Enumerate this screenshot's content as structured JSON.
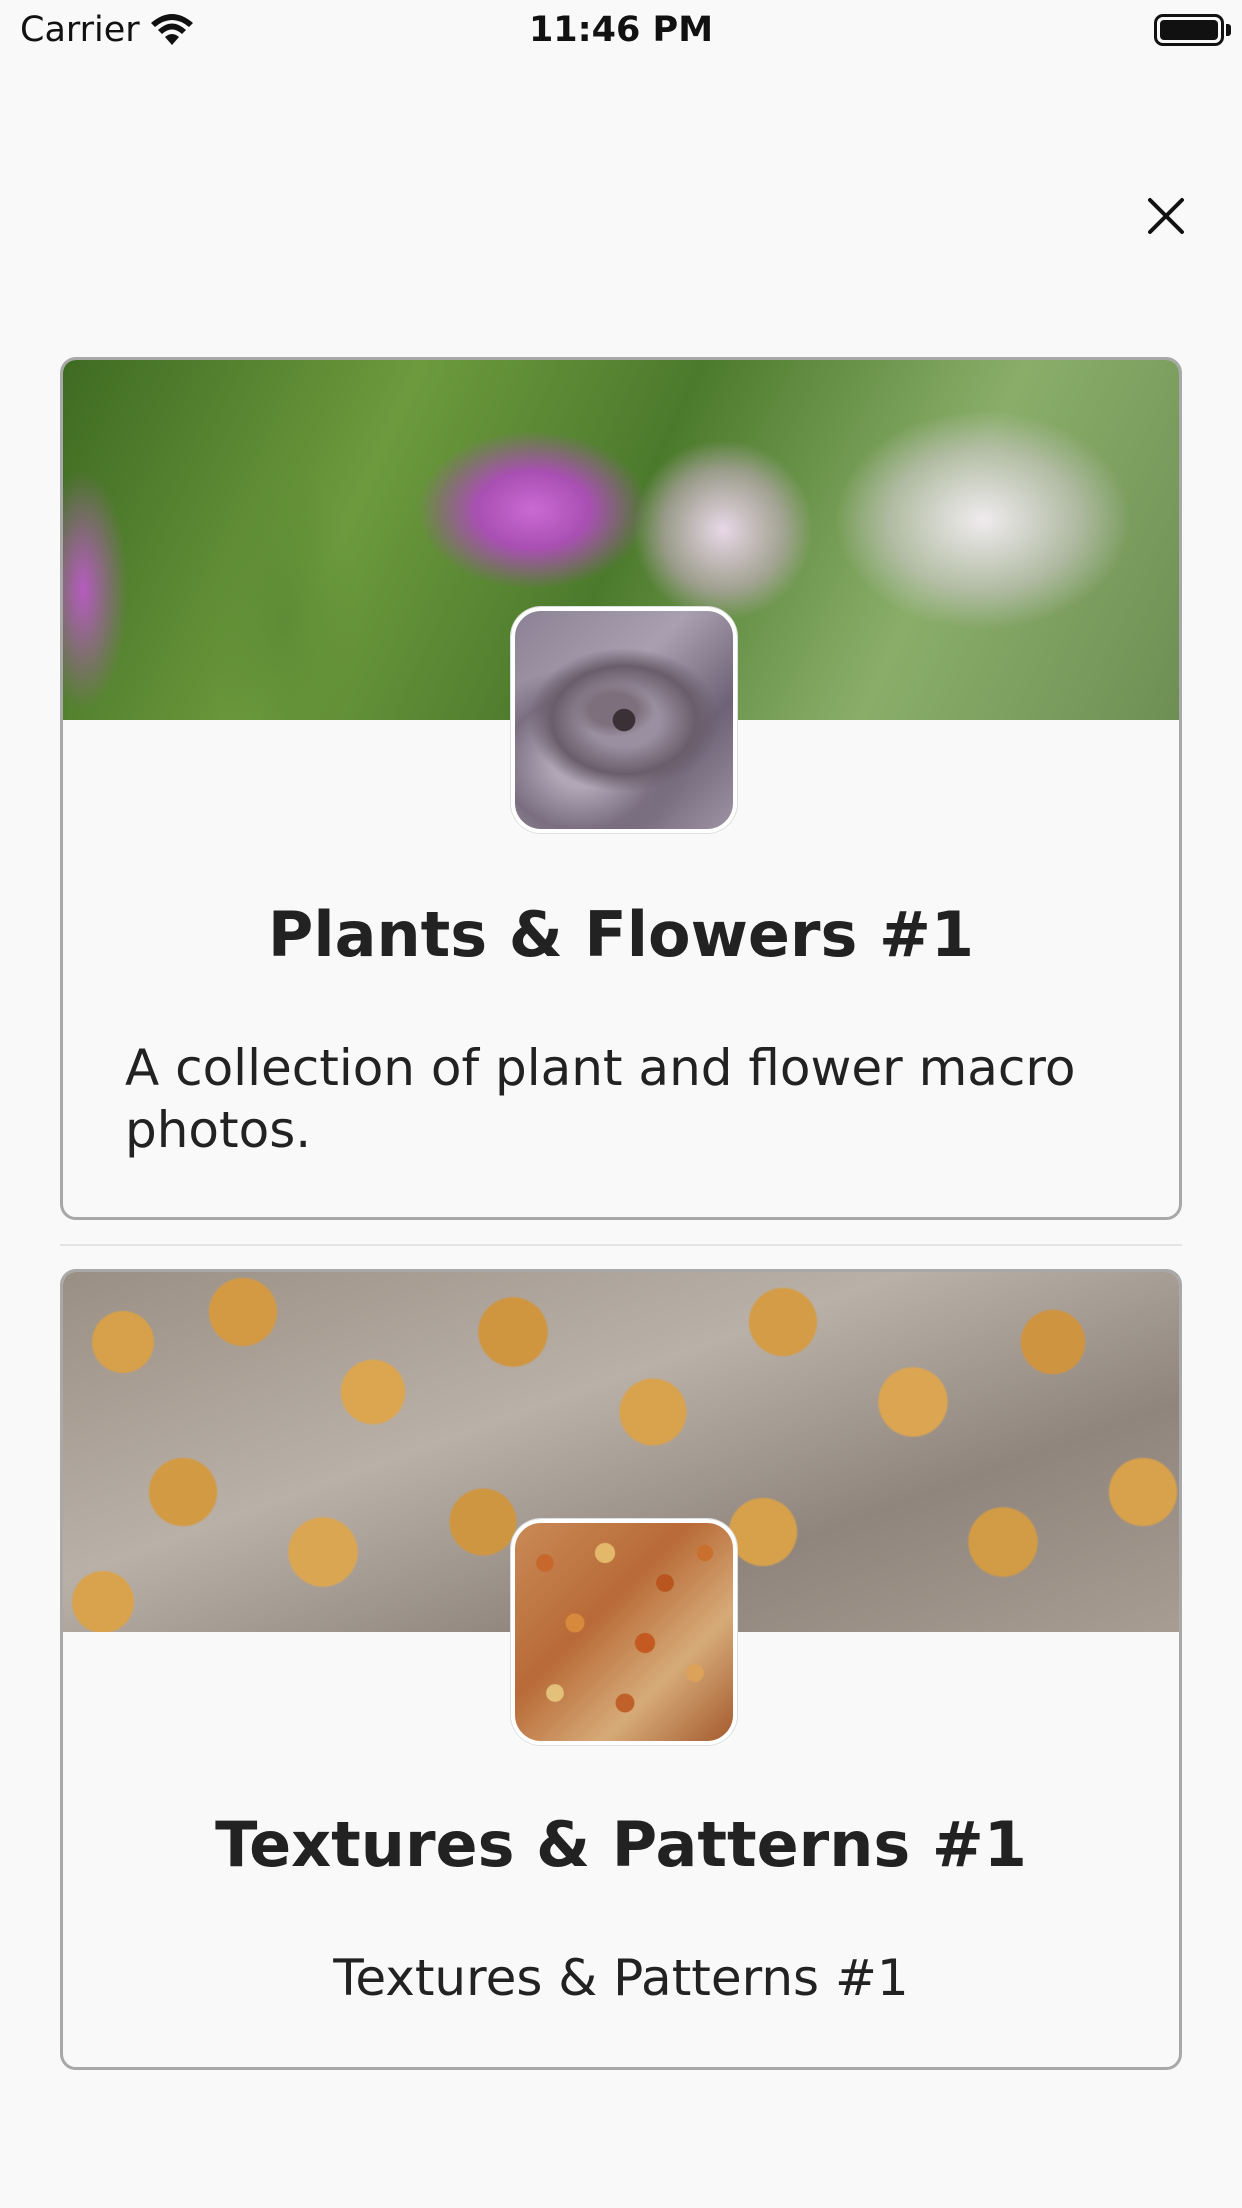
{
  "status_bar": {
    "carrier": "Carrier",
    "time": "11:46 PM",
    "wifi_icon": "wifi-icon",
    "battery_icon": "battery-icon"
  },
  "close_icon": "close-icon",
  "collections": [
    {
      "title": "Plants & Flowers #1",
      "description": "A collection of plant and flower macro photos.",
      "banner_image": "pink-and-white-flowers-photo",
      "thumbnail_image": "succulent-photo"
    },
    {
      "title": "Textures & Patterns #1",
      "description": "Textures & Patterns #1",
      "banner_image": "golden-puffs-texture-photo",
      "thumbnail_image": "star-shapes-texture-photo"
    }
  ]
}
